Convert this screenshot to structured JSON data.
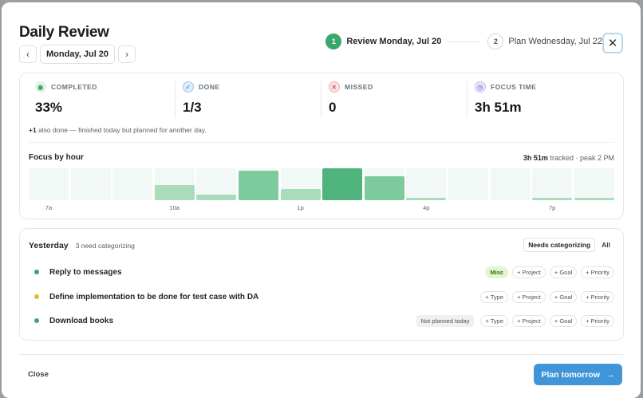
{
  "header": {
    "title": "Daily Review",
    "prev_icon": "chevron-left-icon",
    "next_icon": "chevron-right-icon",
    "date": "Monday, Jul 20",
    "steps": [
      {
        "num": "1",
        "label": "Review Monday, Jul 20"
      },
      {
        "num": "2",
        "label": "Plan Wednesday, Jul 22"
      }
    ],
    "close_icon": "close-icon"
  },
  "stats": [
    {
      "label": "COMPLETED",
      "value": "33%",
      "icon": "target-icon",
      "color": "#3aa76d"
    },
    {
      "label": "DONE",
      "value": "1/3",
      "icon": "check-circle-icon",
      "color": "#3f95d8"
    },
    {
      "label": "MISSED",
      "value": "0",
      "icon": "x-circle-icon",
      "color": "#e05a5a"
    },
    {
      "label": "FOCUS TIME",
      "value": "3h 51m",
      "icon": "clock-icon",
      "color": "#8b6fd6"
    }
  ],
  "note": {
    "strong": "+1",
    "text": " also done — finished today but planned for another day."
  },
  "focus": {
    "title": "Focus by hour",
    "tracked": "3h 51m",
    "tracked_suffix": " tracked · peak 2 PM",
    "hour_labels": [
      "7a",
      "10a",
      "1p",
      "4p",
      "7p"
    ],
    "levels": [
      0,
      0,
      0,
      0.48,
      0.18,
      0.92,
      0.35,
      1.0,
      0.75,
      0.08,
      0,
      0,
      0.08,
      0.08
    ]
  },
  "list": {
    "title": "Yesterday",
    "subtitle": "3 need categorizing",
    "filters": [
      "Needs categorizing",
      "All"
    ],
    "tasks": [
      {
        "name": "Reply to messages",
        "dot": "#3aa76d",
        "np": "",
        "chips": [
          "Misc",
          "+ Project",
          "+ Goal",
          "+ Priority"
        ]
      },
      {
        "name": "Define implementation to be done for test case with DA",
        "dot": "#e8b828",
        "np": "",
        "chips": [
          "+ Type",
          "+ Project",
          "+ Goal",
          "+ Priority"
        ]
      },
      {
        "name": "Download books",
        "dot": "#3aa76d",
        "np": "Not planned today",
        "chips": [
          "+ Type",
          "+ Project",
          "+ Goal",
          "+ Priority"
        ]
      }
    ]
  },
  "footer": {
    "close": "Close",
    "primary": "Plan tomorrow",
    "primary_icon": "arrow-right-icon"
  }
}
